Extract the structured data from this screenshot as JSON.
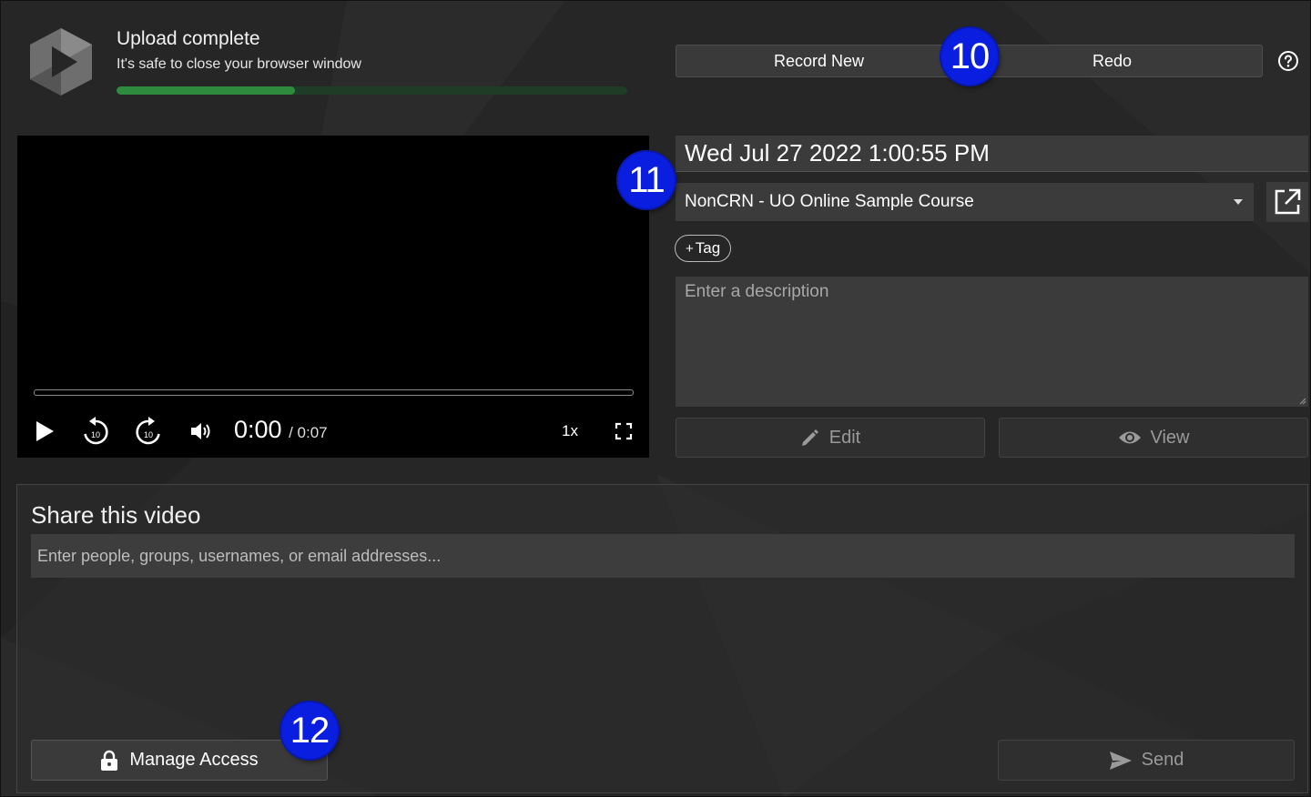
{
  "header": {
    "status_title": "Upload complete",
    "status_subtitle": "It's safe to close your browser window",
    "upload_progress_fraction": 0.35,
    "record_new_label": "Record New",
    "redo_label": "Redo",
    "help_icon": "question-circle-icon"
  },
  "player": {
    "current_time": "0:00",
    "total_time": "/ 0:07",
    "speed": "1x",
    "seek_fraction": 0,
    "icons": [
      "play-icon",
      "rewind-10-icon",
      "forward-10-icon",
      "volume-icon",
      "fullscreen-icon"
    ]
  },
  "details": {
    "title_value": "Wed Jul 27 2022 1:00:55 PM",
    "folder_value": "NonCRN - UO Online Sample Course",
    "tag_label": "Tag",
    "description_placeholder": "Enter a description",
    "edit_label": "Edit",
    "view_label": "View"
  },
  "share": {
    "title": "Share this video",
    "input_placeholder": "Enter people, groups, usernames, or email addresses...",
    "manage_access_label": "Manage Access",
    "send_label": "Send"
  },
  "callouts": [
    "10",
    "11",
    "12"
  ],
  "colors": {
    "background": "#262626",
    "progress_fill": "#2e8b3e",
    "callout_blue": "#0a1ee0"
  }
}
